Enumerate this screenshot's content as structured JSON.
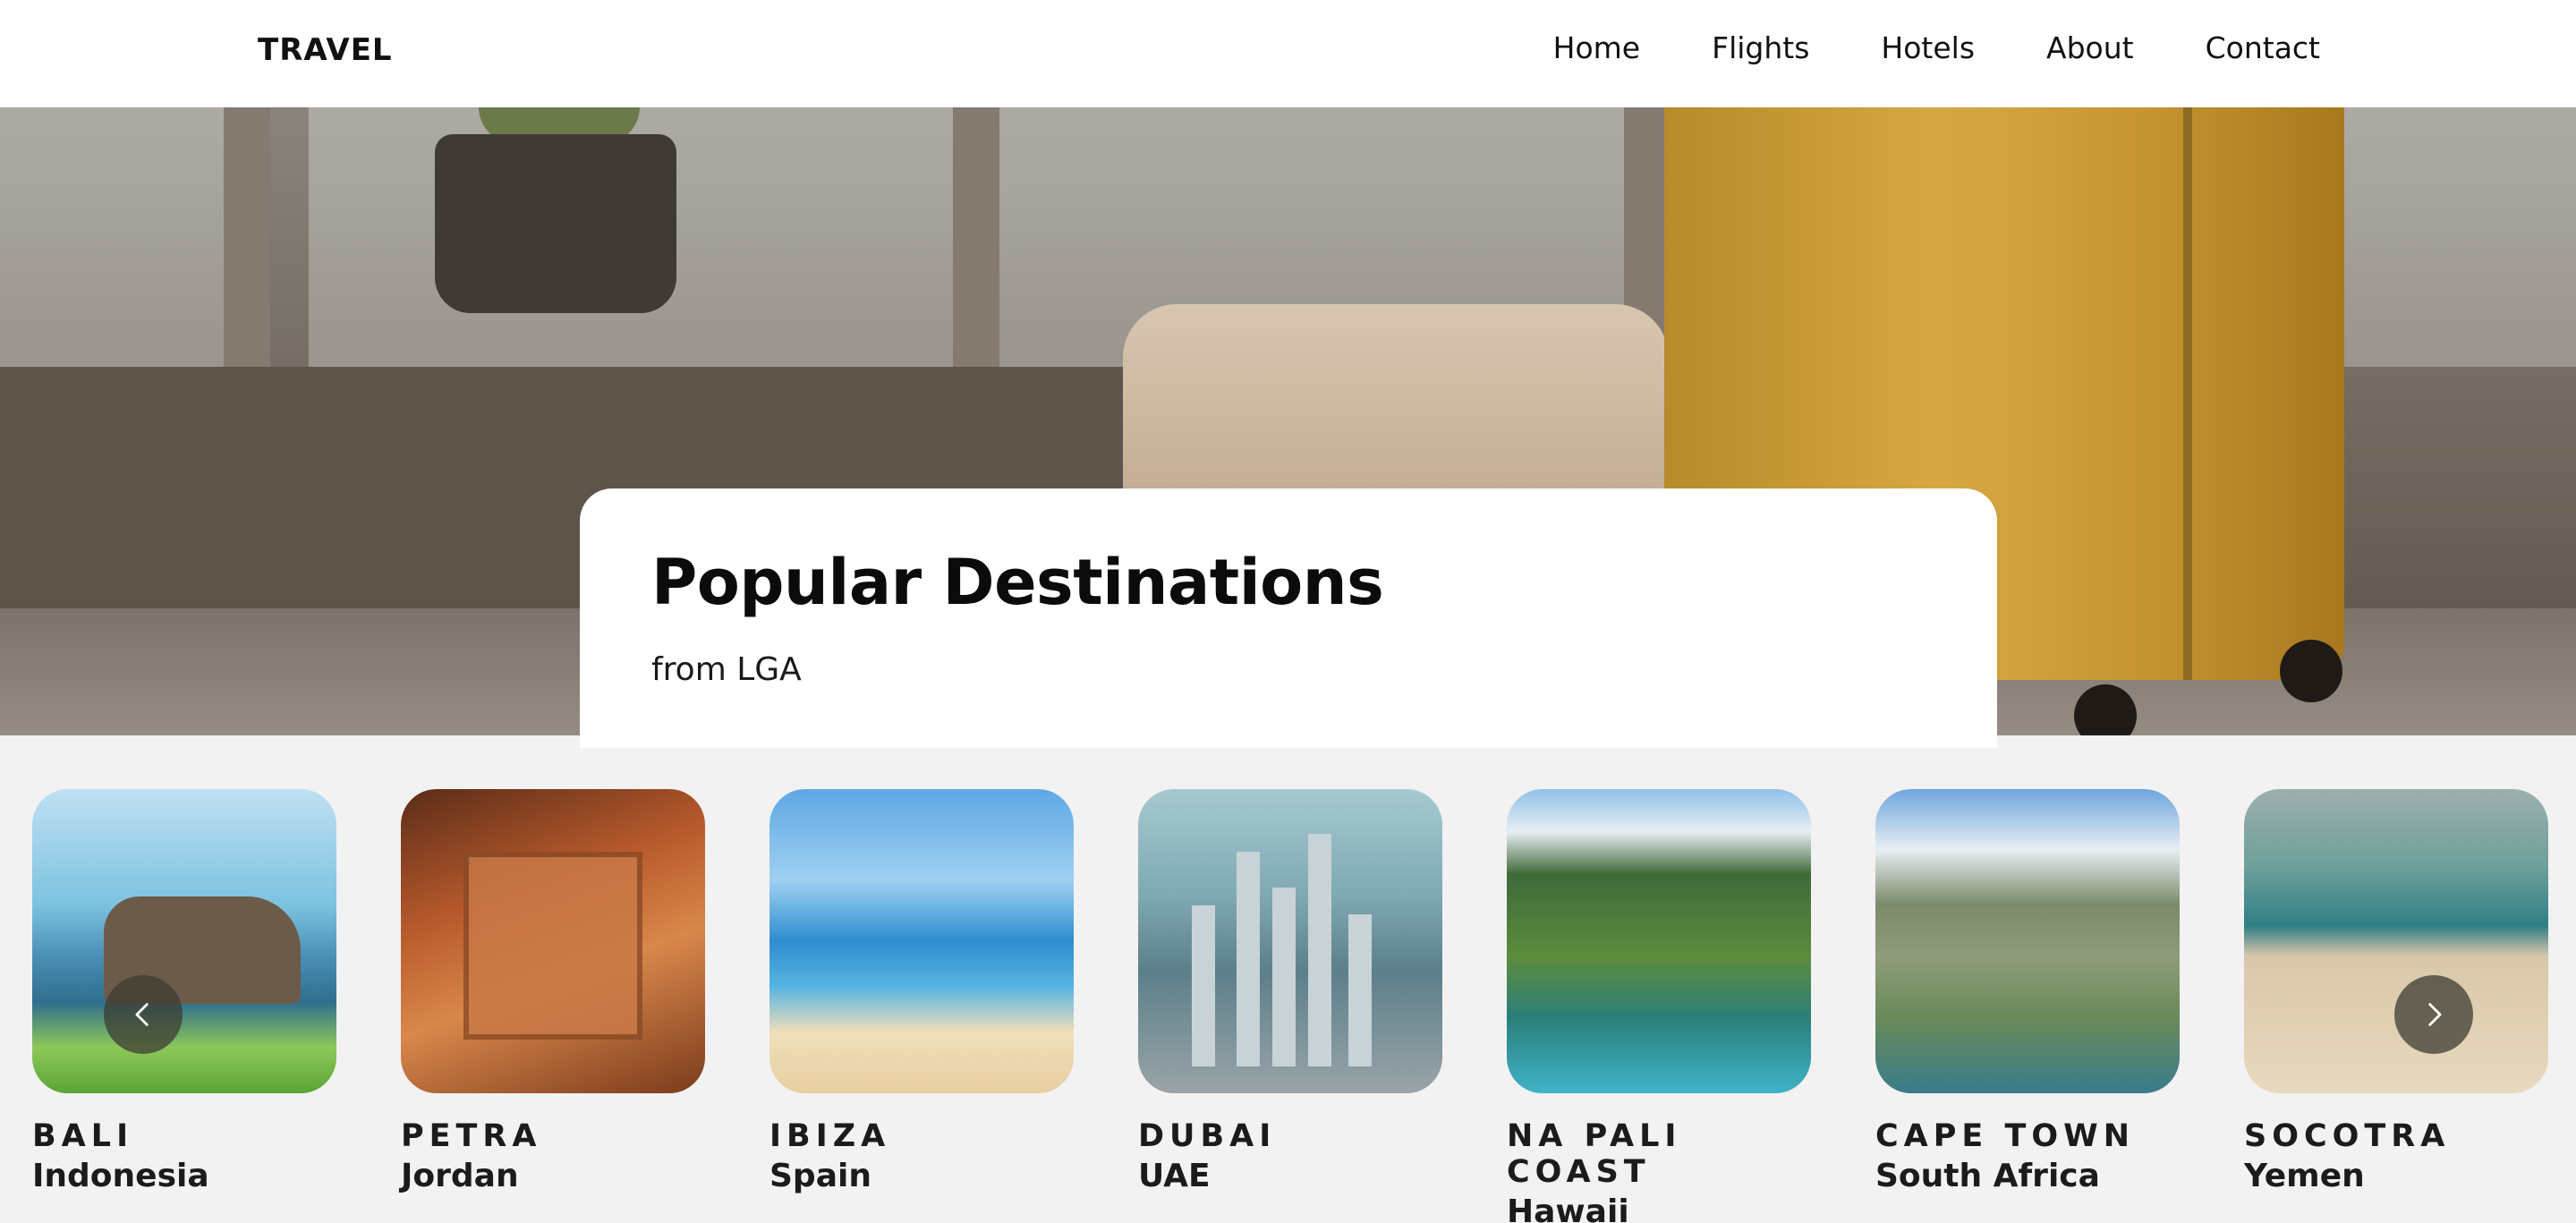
{
  "nav": {
    "brand": "TRAVEL",
    "links": [
      "Home",
      "Flights",
      "Hotels",
      "About",
      "Contact"
    ]
  },
  "hero": {
    "title": "Popular Destinations",
    "subtitle": "from LGA"
  },
  "destinations": [
    {
      "name": "BALI",
      "country": "Indonesia"
    },
    {
      "name": "PETRA",
      "country": "Jordan"
    },
    {
      "name": "IBIZA",
      "country": "Spain"
    },
    {
      "name": "DUBAI",
      "country": "UAE"
    },
    {
      "name": "NA PALI COAST",
      "country": "Hawaii"
    },
    {
      "name": "CAPE TOWN",
      "country": "South Africa"
    },
    {
      "name": "SOCOTRA",
      "country": "Yemen"
    }
  ],
  "icons": {
    "prev": "chevron-left-icon",
    "next": "chevron-right-icon"
  }
}
